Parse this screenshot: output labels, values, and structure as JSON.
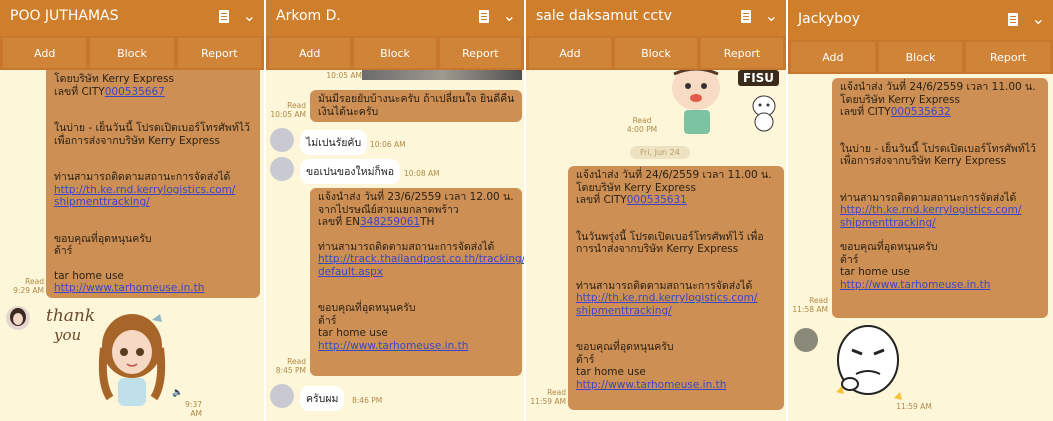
{
  "actions": {
    "add": "Add",
    "block": "Block",
    "report": "Report"
  },
  "panel1": {
    "title": "POO JUTHAMAS",
    "msg": {
      "l1": "โดยบริษัท Kerry Express",
      "l2a": "เลขที่ CITY",
      "l2b": "000535667",
      "l3": "ในบ่าย - เย็นวันนี้ โปรดเปิดเบอร์โทรศัพท์ไว้",
      "l4": "เพื่อการส่งจากบริษัท Kerry Express",
      "l5": "ท่านสามารถติดตามสถานะการจัดส่งได้",
      "l6": "http://th.ke.rnd.kerrylogistics.com/",
      "l7": "shipmenttracking/",
      "l8": "ขอบคุณที่อุดหนุนครับ",
      "l9": "ต้าร์",
      "l10": "tar home use",
      "l11": "http://www.tarhomeuse.in.th"
    },
    "read": "Read",
    "time1": "9:29 AM",
    "sticker_text1": "thank",
    "sticker_text2": "you",
    "time2": "9:37 AM"
  },
  "panel2": {
    "title": "Arkom D.",
    "time_top": "10:05 AM",
    "msg1a": "มันมีรอยยับบ้างนะครับ ถ้าเปลี่ยนใจ ยินดีคืน",
    "msg1b": "เงินได้นะครับ",
    "read1": "Read",
    "time1": "10:05 AM",
    "in1": "ไม่เปนรัยคับ",
    "in1_time": "10:06 AM",
    "in2": "ขอเปนของใหม่ก็พอ",
    "in2_time": "10:08 AM",
    "msg2": {
      "l1": "แจ้งนำส่ง วันที่ 23/6/2559 เวลา 12.00 น.",
      "l2": "จากไปรษณีย์สามแยกลาดพร้าว",
      "l3a": "เลขที่ EN",
      "l3b": "348259061",
      "l3c": "TH",
      "l4": "ท่านสามารถติดตามสถานะการจัดส่งได้",
      "l5": "http://track.thailandpost.co.th/tracking/",
      "l6": "default.aspx",
      "l7": "ขอบคุณที่อุดหนุนครับ",
      "l8": "ต้าร์",
      "l9": "tar home use",
      "l10": "http://www.tarhomeuse.in.th"
    },
    "read2": "Read",
    "time2": "8:45 PM",
    "in3": "ครับผม",
    "in3_time": "8:46 PM"
  },
  "panel3": {
    "title": "sale daksamut cctv",
    "sticker_text": "FISU",
    "read1": "Read",
    "time1": "4:00 PM",
    "date": "Fri, Jun 24",
    "msg": {
      "l1": "แจ้งนำส่ง วันที่    24/6/2559 เวลา 11.00 น.",
      "l2": "โดยบริษัท Kerry Express",
      "l3a": "เลขที่ CITY",
      "l3b": "000535631",
      "l4": "ในวันพรุ่งนี้ โปรดเปิดเบอร์โทรศัพท์ไว้ เพื่อ",
      "l5": "การนำส่งจากบริษัท Kerry Express",
      "l6": "ท่านสามารถติดตามสถานะการจัดส่งได้",
      "l7": "http://th.ke.rnd.kerrylogistics.com/",
      "l8": "shipmenttracking/",
      "l9": "ขอบคุณที่อุดหนุนครับ",
      "l10": "ต้าร์",
      "l11": "tar home use",
      "l12": "http://www.tarhomeuse.in.th"
    },
    "read2": "Read",
    "time2": "11:59 AM"
  },
  "panel4": {
    "title": "Jackyboy",
    "msg": {
      "l1": "แจ้งนำส่ง วันที่    24/6/2559 เวลา 11.00 น.",
      "l2": "โดยบริษัท Kerry Express",
      "l3a": "เลขที่ CITY",
      "l3b": "000535632",
      "l4": "ในบ่าย - เย็นวันนี้ โปรดเปิดเบอร์โทรศัพท์ไว้",
      "l5": "เพื่อการส่งจากบริษัท Kerry Express",
      "l6": "ท่านสามารถติดตามสถานะการจัดส่งได้",
      "l7": "http://th.ke.rnd.kerrylogistics.com/",
      "l8": "shipmenttracking/",
      "l9": "ขอบคุณที่อุดหนุนครับ",
      "l10": "ต้าร์",
      "l11": "tar home use",
      "l12": "http://www.tarhomeuse.in.th"
    },
    "read": "Read",
    "time1": "11:58 AM",
    "time2": "11:59 AM"
  }
}
